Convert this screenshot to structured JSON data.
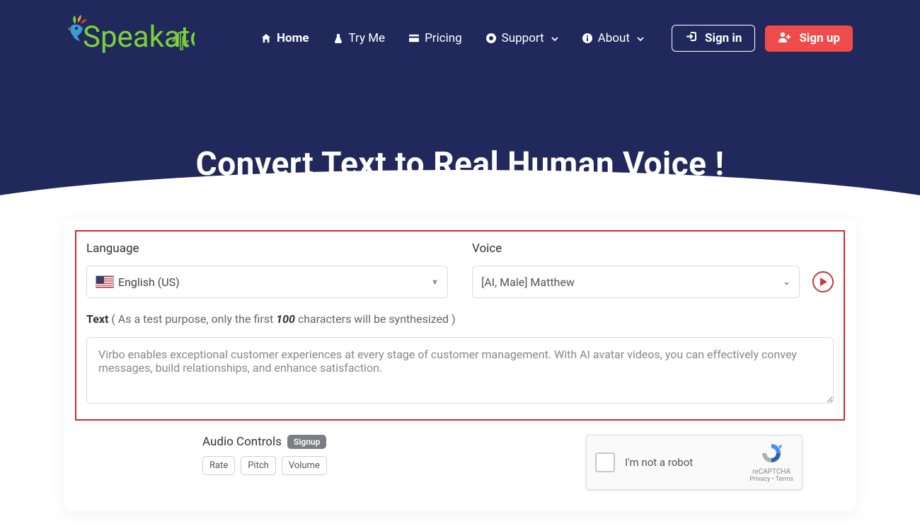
{
  "nav": {
    "logo_text": "Speakatoo",
    "items": [
      {
        "label": "Home",
        "icon": "home"
      },
      {
        "label": "Try Me",
        "icon": "flask"
      },
      {
        "label": "Pricing",
        "icon": "card"
      },
      {
        "label": "Support",
        "icon": "help",
        "dropdown": true
      },
      {
        "label": "About",
        "icon": "info",
        "dropdown": true
      }
    ],
    "signin_label": "Sign in",
    "signup_label": "Sign up"
  },
  "headline": "Convert Text to Real Human Voice !",
  "form": {
    "language_label": "Language",
    "language_value": "English (US)",
    "voice_label": "Voice",
    "voice_value": "[AI, Male] Matthew",
    "text_label_bold": "Text",
    "text_label_pre": " ( As a test purpose, only the first ",
    "text_label_count": "100",
    "text_label_post": " characters will be synthesized )",
    "text_value": "Virbo enables exceptional customer experiences at every stage of customer management. With AI avatar videos, you can effectively convey messages, build relationships, and enhance satisfaction."
  },
  "audio": {
    "title": "Audio Controls",
    "badge": "Signup",
    "chips": [
      "Rate",
      "Pitch",
      "Volume"
    ]
  },
  "captcha": {
    "label": "I'm not a robot",
    "brand": "reCAPTCHA",
    "links": "Privacy • Terms"
  }
}
